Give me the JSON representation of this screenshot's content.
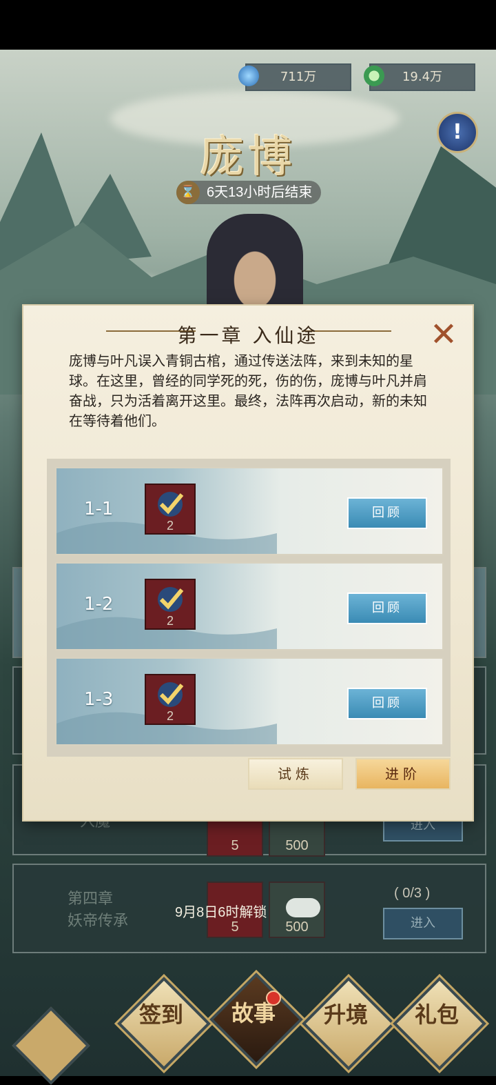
{
  "currency": [
    {
      "icon": "crystal-icon",
      "value": "711万"
    },
    {
      "icon": "jade-coin-icon",
      "value": "19.4万"
    }
  ],
  "event": {
    "title": "庞博",
    "timer": "6天13小时后结束"
  },
  "background_chapters": [
    {
      "name": "入魔",
      "reward1": "5",
      "reward2": "500",
      "enter": "进入"
    },
    {
      "name_line1": "第四章",
      "name_line2": "妖帝传承",
      "reward1": "5",
      "reward2": "500",
      "progress": "( 0/3 )",
      "enter": "进入",
      "unlock": "9月8日6时解锁"
    }
  ],
  "dialog": {
    "title": "第一章   入仙途",
    "description": "庞博与叶凡误入青铜古棺，通过传送法阵，来到未知的星球。在这里，曾经的同学死的死，伤的伤，庞博与叶凡并肩奋战，只为活着离开这里。最终，法阵再次启动，新的未知在等待着他们。",
    "stages": [
      {
        "id": "1-1",
        "reward_count": "2",
        "button": "回顾"
      },
      {
        "id": "1-2",
        "reward_count": "2",
        "button": "回顾"
      },
      {
        "id": "1-3",
        "reward_count": "2",
        "button": "回顾"
      }
    ],
    "tabs": {
      "trial": "试炼",
      "advance": "进阶"
    }
  },
  "nav": [
    {
      "label": "签到",
      "active": false
    },
    {
      "label": "故事",
      "active": true,
      "badge": true
    },
    {
      "label": "升境",
      "active": false
    },
    {
      "label": "礼包",
      "active": false
    }
  ],
  "colors": {
    "accent_gold": "#c9a96a",
    "review_blue": "#4a9bc4",
    "close_red": "#a0522d"
  }
}
